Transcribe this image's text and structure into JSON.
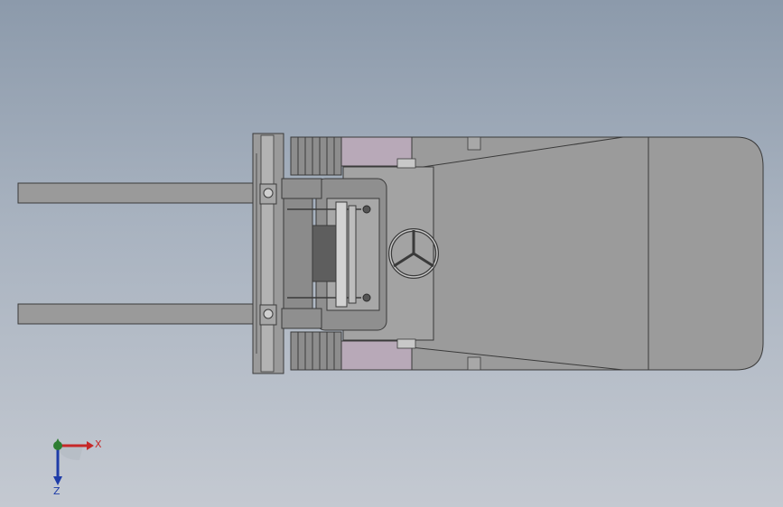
{
  "viewport": {
    "background_top": "#8c9aab",
    "background_bottom": "#c4c9d1"
  },
  "model": {
    "body_color": "#999999",
    "dark_color": "#6f6f6f",
    "tire_color": "#b8a9b8",
    "outline_color": "#3a3a3a"
  },
  "triad": {
    "x_label": "X",
    "z_label": "Z",
    "x_color": "#c62828",
    "y_color": "#2e7d32",
    "z_color": "#1e3ca8"
  }
}
